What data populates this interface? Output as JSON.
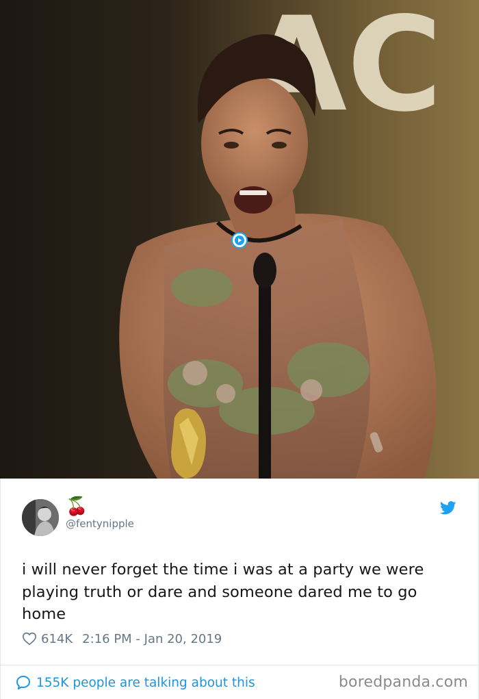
{
  "tweet": {
    "display_name": "🍒",
    "handle": "@fentynipple",
    "text": "i will never forget the time i was at a party we were playing truth or dare and someone dared me to go home",
    "likes": "614K",
    "timestamp": "2:16 PM - Jan 20, 2019",
    "talking": "155K people are talking about this"
  },
  "media": {
    "backdrop_letters": "AC"
  },
  "watermark": "boredpanda.com",
  "colors": {
    "twitter_blue": "#1da1f2",
    "link_blue": "#1b95e0",
    "meta_gray": "#657786",
    "text": "#14171a",
    "border": "#e1e8ed"
  },
  "icons": {
    "play": "play-icon",
    "verified_bird": "twitter-bird-icon",
    "like": "heart-icon",
    "conversation": "speech-bubble-icon"
  }
}
